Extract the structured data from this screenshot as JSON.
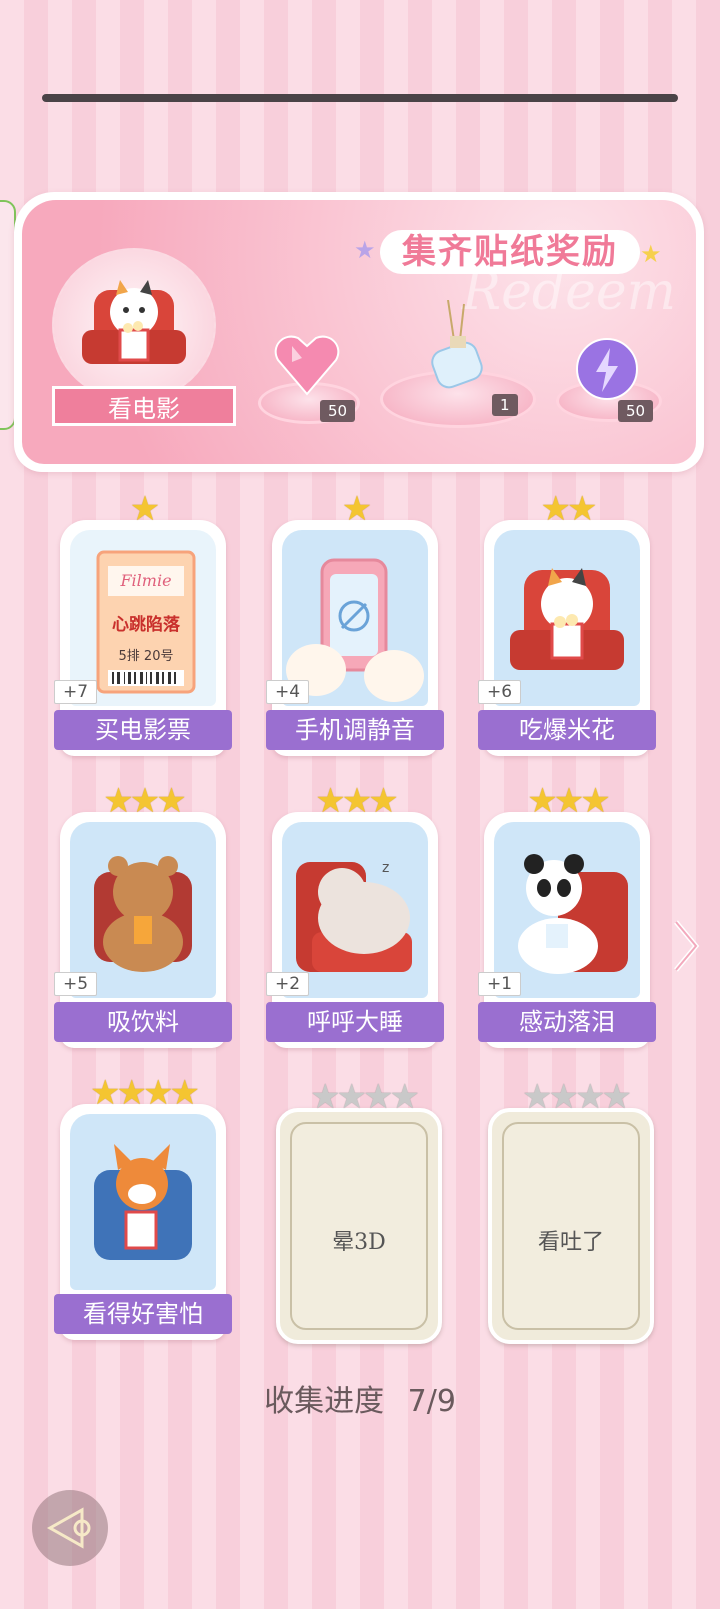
{
  "banner": {
    "title": "集齐贴纸奖励",
    "ghost_text": "Redeem",
    "theme_label": "看电影",
    "rewards": [
      {
        "icon": "heart-gem-icon",
        "count": "50"
      },
      {
        "icon": "bottle-charm-icon",
        "count": "1"
      },
      {
        "icon": "lightning-orb-icon",
        "count": "50"
      }
    ]
  },
  "stickers": [
    {
      "name": "买电影票",
      "bonus": "+7",
      "stars": 1,
      "unlocked": true,
      "art": "ticket-art",
      "ticket": {
        "brand": "Filmie",
        "title": "心跳陷落",
        "seat": "5排 20号"
      }
    },
    {
      "name": "手机调静音",
      "bonus": "+4",
      "stars": 1,
      "unlocked": true,
      "art": "phone-mute-art"
    },
    {
      "name": "吃爆米花",
      "bonus": "+6",
      "stars": 2,
      "unlocked": true,
      "art": "cat-popcorn-art"
    },
    {
      "name": "吸饮料",
      "bonus": "+5",
      "stars": 3,
      "unlocked": true,
      "art": "bear-drink-art"
    },
    {
      "name": "呼呼大睡",
      "bonus": "+2",
      "stars": 3,
      "unlocked": true,
      "art": "hamster-sleep-art"
    },
    {
      "name": "感动落泪",
      "bonus": "+1",
      "stars": 3,
      "unlocked": true,
      "art": "panda-cry-art"
    },
    {
      "name": "看得好害怕",
      "bonus": "",
      "stars": 4,
      "unlocked": true,
      "art": "fox-scared-art"
    },
    {
      "name": "晕3D",
      "bonus": "",
      "stars": 4,
      "unlocked": false,
      "art": ""
    },
    {
      "name": "看吐了",
      "bonus": "",
      "stars": 4,
      "unlocked": false,
      "art": ""
    }
  ],
  "progress": {
    "label": "收集进度",
    "value": "7/9"
  },
  "colors": {
    "card_label": "#9a6fd0",
    "banner_accent": "#ef7f9c",
    "star_gold": "#f4c531",
    "star_grey": "#c9c9c9"
  }
}
